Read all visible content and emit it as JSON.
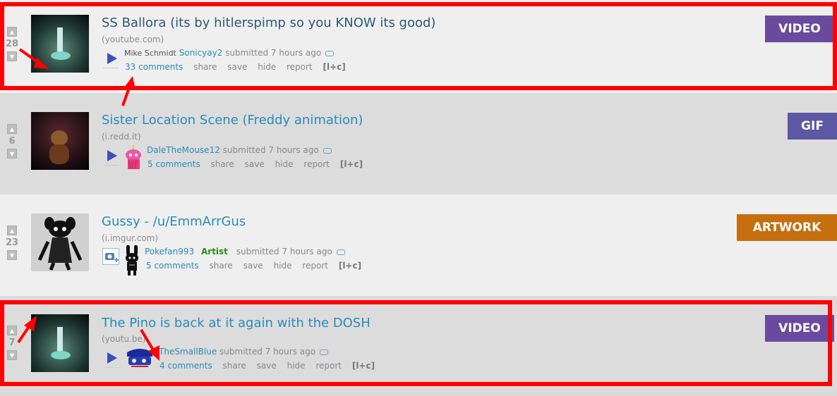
{
  "posts": [
    {
      "score": "28",
      "title": "SS Ballora (its by hitlerspimp so you KNOW its good)",
      "domain": "(youtube.com)",
      "author_prefix": "Mike Schmidt",
      "author": "Sonicyay2",
      "submitted": "submitted 7 hours ago",
      "comments": "33 comments",
      "actions": [
        "share",
        "save",
        "hide",
        "report"
      ],
      "lc": "[l+c]",
      "badge": "VIDEO"
    },
    {
      "score": "6",
      "title": "Sister Location Scene (Freddy animation)",
      "domain": "(i.redd.it)",
      "author": "DaleTheMouse12",
      "submitted": "submitted 7 hours ago",
      "comments": "5 comments",
      "actions": [
        "share",
        "save",
        "hide",
        "report"
      ],
      "lc": "[l+c]",
      "badge": "GIF"
    },
    {
      "score": "23",
      "title": "Gussy - /u/EmmArrGus",
      "domain": "(i.imgur.com)",
      "author": "Pokefan993",
      "flair": "Artist",
      "submitted": "submitted 7 hours ago",
      "comments": "5 comments",
      "actions": [
        "share",
        "save",
        "hide",
        "report"
      ],
      "lc": "[l+c]",
      "badge": "ARTWORK"
    },
    {
      "score": "7",
      "title": "The Pino is back at it again with the DOSH",
      "domain": "(youtu.be)",
      "author": "TheSmallBlue",
      "submitted": "submitted 7 hours ago",
      "comments": "4 comments",
      "actions": [
        "share",
        "save",
        "hide",
        "report"
      ],
      "lc": "[l+c]",
      "badge": "VIDEO"
    }
  ],
  "colors": {
    "link": "#2a8bb9",
    "video_badge": "#6a4a9e",
    "gif_badge": "#5c58a4",
    "artwork_badge": "#c66f0f",
    "highlight": "#ff0000"
  },
  "icons": [
    "upvote-arrow-icon",
    "downvote-arrow-icon",
    "play-icon",
    "tag-icon",
    "camera-plus-icon"
  ]
}
